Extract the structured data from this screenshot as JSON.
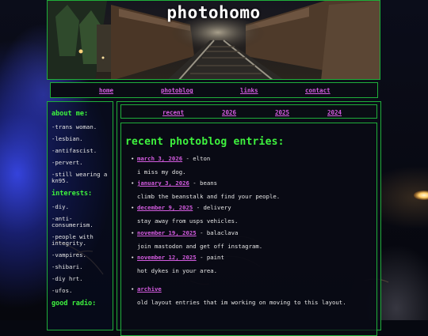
{
  "header": {
    "title": "photohomo"
  },
  "nav": {
    "links": [
      {
        "label": "home"
      },
      {
        "label": "photoblog"
      },
      {
        "label": "links"
      },
      {
        "label": "contact"
      }
    ]
  },
  "sidebar": {
    "about_heading": "about me:",
    "about_items": [
      "-trans woman.",
      "-lesbian.",
      "-antifascist.",
      "-pervert.",
      "-still wearing a kn95."
    ],
    "interests_heading": "interests:",
    "interests_items": [
      "-diy.",
      "-anti-consumerism.",
      "-people with integrity.",
      "-vampires.",
      "-shibari.",
      "-diy hrt.",
      "-ufos."
    ],
    "radio_heading": "good radio:"
  },
  "years": {
    "links": [
      {
        "label": "recent"
      },
      {
        "label": "2026"
      },
      {
        "label": "2025"
      },
      {
        "label": "2024"
      }
    ]
  },
  "entries": {
    "title": "recent photoblog entries:",
    "items": [
      {
        "date": "march 3, 2026",
        "title": " - elton",
        "desc": "i miss my dog."
      },
      {
        "date": "january 3, 2026",
        "title": " - beans",
        "desc": "climb the beanstalk and find your people."
      },
      {
        "date": "december 9, 2025",
        "title": " - delivery",
        "desc": "stay away from usps vehicles."
      },
      {
        "date": "november 19, 2025",
        "title": " - balaclava",
        "desc": "join mastodon and get off instagram."
      },
      {
        "date": "november 12, 2025",
        "title": " - paint",
        "desc": "hot dykes in your area."
      },
      {
        "date": "archive",
        "title": "",
        "desc": "old layout entries that im working on moving to this layout."
      }
    ]
  },
  "colors": {
    "accent_green": "#3ef23e",
    "border_green": "#1fae3a",
    "link_purple": "#d45ce0"
  }
}
